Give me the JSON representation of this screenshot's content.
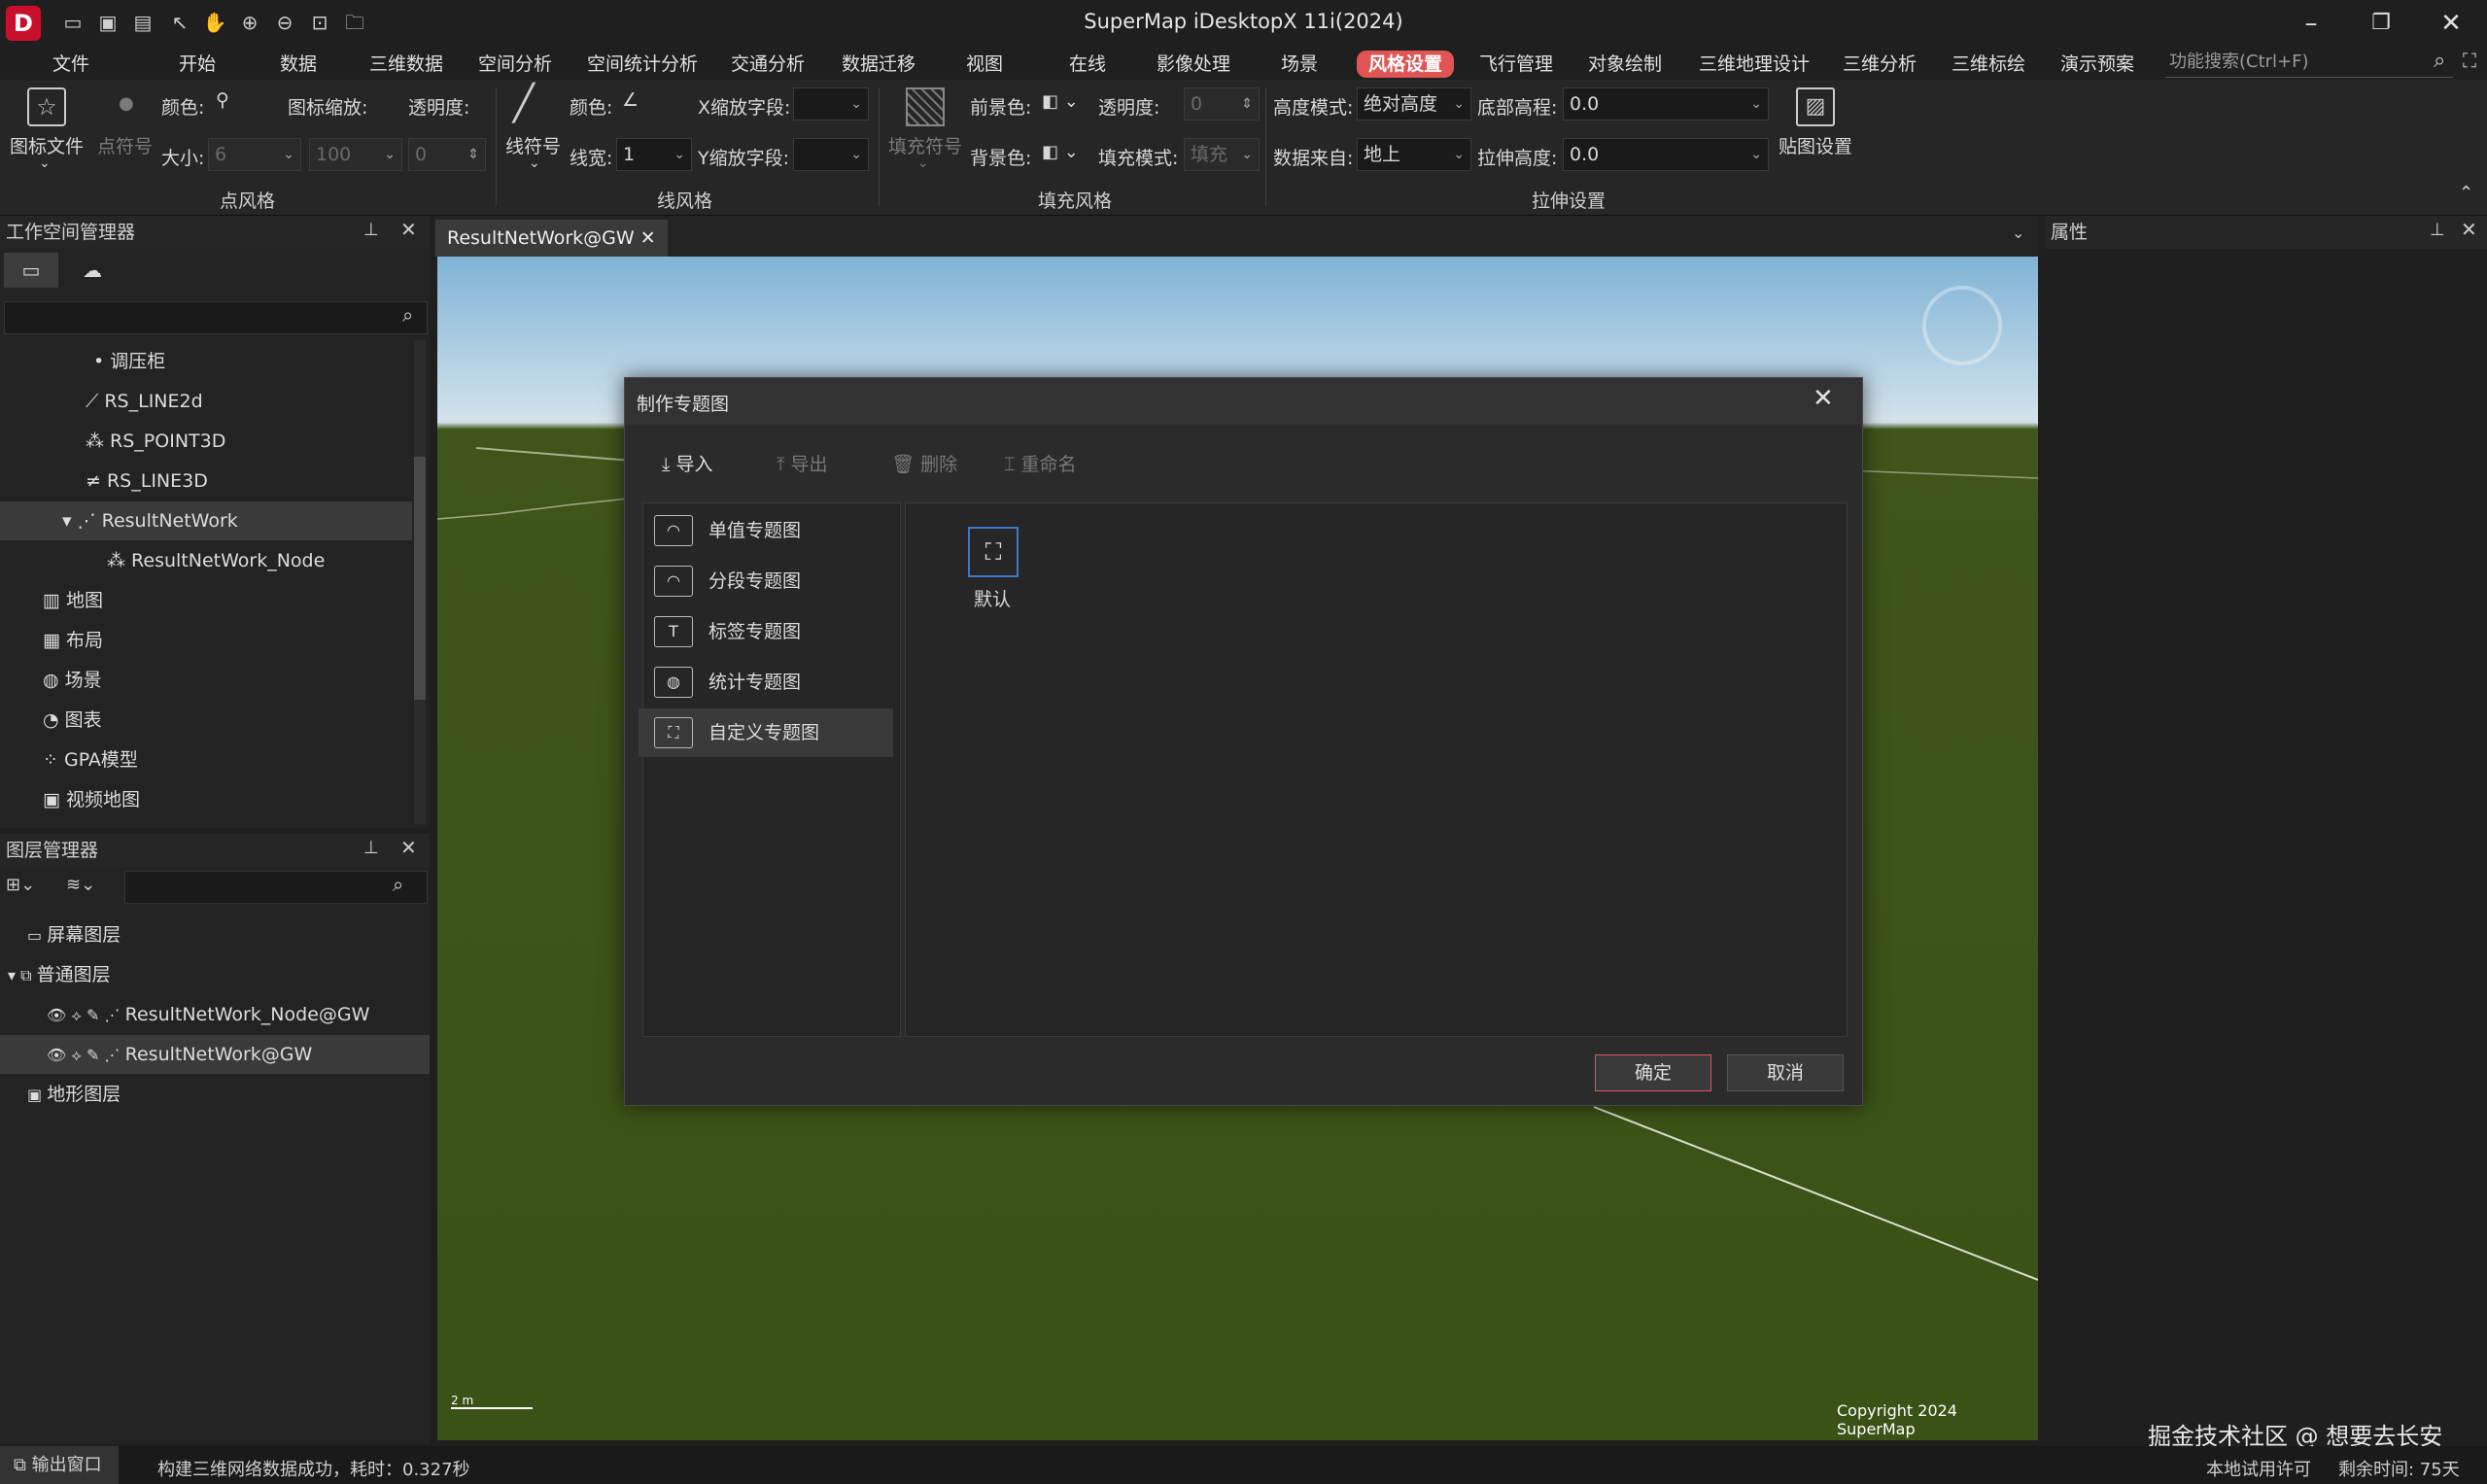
{
  "app": {
    "title": "SuperMap iDesktopX 11i(2024)",
    "logo": "D"
  },
  "quick_access_icons": [
    "save-icon",
    "save-as-icon",
    "save-all-icon",
    "select-icon",
    "pan-icon",
    "zoom-in-icon",
    "zoom-out-icon",
    "full-extent-icon",
    "open-folder-icon"
  ],
  "menu": [
    "文件",
    "开始",
    "数据",
    "三维数据",
    "空间分析",
    "空间统计分析",
    "交通分析",
    "数据迁移",
    "视图",
    "在线",
    "影像处理",
    "场景",
    "风格设置",
    "飞行管理",
    "对象绘制",
    "三维地理设计",
    "三维分析",
    "三维标绘",
    "演示预案"
  ],
  "menu_active": "风格设置",
  "search_placeholder": "功能搜索(Ctrl+F)",
  "ribbon": {
    "point": {
      "icon_file": "图标文件",
      "point_symbol": "点符号",
      "color": "颜色:",
      "icon_scale": "图标缩放:",
      "opacity": "透明度:",
      "size": "大小:",
      "size_val": "6",
      "scale_val": "100",
      "opacity_val": "0",
      "group": "点风格"
    },
    "line": {
      "line_symbol": "线符号",
      "color": "颜色:",
      "width": "线宽:",
      "width_val": "1",
      "x_scale": "X缩放字段:",
      "y_scale": "Y缩放字段:",
      "group": "线风格"
    },
    "fill": {
      "fill_symbol": "填充符号",
      "fg": "前景色:",
      "bg": "背景色:",
      "opacity": "透明度:",
      "opacity_val": "0",
      "fill_mode": "填充模式:",
      "fill_mode_val": "填充",
      "group": "填充风格"
    },
    "extrude": {
      "height_mode": "高度模式:",
      "height_mode_val": "绝对高度",
      "bottom": "底部高程:",
      "bottom_val": "0.0",
      "source": "数据来自:",
      "source_val": "地上",
      "extrude_h": "拉伸高度:",
      "extrude_val": "0.0",
      "texture": "贴图设置",
      "group": "拉伸设置"
    }
  },
  "workspace": {
    "title": "工作空间管理器",
    "items": [
      {
        "label": "调压柜",
        "icon": "point-dataset-icon"
      },
      {
        "label": "RS_LINE2d",
        "icon": "line-dataset-icon"
      },
      {
        "label": "RS_POINT3D",
        "icon": "point3d-dataset-icon"
      },
      {
        "label": "RS_LINE3D",
        "icon": "line3d-dataset-icon"
      },
      {
        "label": "ResultNetWork",
        "icon": "network-dataset-icon"
      },
      {
        "label": "ResultNetWork_Node",
        "icon": "point3d-dataset-icon"
      },
      {
        "label": "地图",
        "icon": "map-icon"
      },
      {
        "label": "布局",
        "icon": "layout-icon"
      },
      {
        "label": "场景",
        "icon": "scene-icon"
      },
      {
        "label": "图表",
        "icon": "chart-icon"
      },
      {
        "label": "GPA模型",
        "icon": "gpa-icon"
      },
      {
        "label": "视频地图",
        "icon": "video-map-icon"
      }
    ]
  },
  "layers": {
    "title": "图层管理器",
    "items": [
      {
        "label": "屏幕图层"
      },
      {
        "label": "普通图层"
      },
      {
        "label": "ResultNetWork_Node@GW"
      },
      {
        "label": "ResultNetWork@GW"
      },
      {
        "label": "地形图层"
      }
    ]
  },
  "doc_tab": "ResultNetWork@GW",
  "properties_title": "属性",
  "dialog": {
    "title": "制作专题图",
    "toolbar": {
      "import": "导入",
      "export": "导出",
      "delete": "删除",
      "rename": "重命名"
    },
    "themes": [
      {
        "label": "单值专题图",
        "icon": "unique-theme-icon"
      },
      {
        "label": "分段专题图",
        "icon": "range-theme-icon"
      },
      {
        "label": "标签专题图",
        "icon": "label-theme-icon"
      },
      {
        "label": "统计专题图",
        "icon": "graph-theme-icon"
      },
      {
        "label": "自定义专题图",
        "icon": "custom-theme-icon"
      }
    ],
    "selected_theme": 4,
    "template": {
      "label": "默认"
    },
    "ok": "确定",
    "cancel": "取消"
  },
  "map": {
    "copyright": "Copyright 2024 SuperMap",
    "scale": "2 m"
  },
  "watermark": "掘金技术社区 @ 想要去长安",
  "status": {
    "output": "输出窗口",
    "message": "构建三维网络数据成功，耗时：0.327秒",
    "license": "本地试用许可",
    "remaining": "剩余时间: 75天"
  },
  "colors": {
    "accent": "#e05454",
    "bg": "#1f1f1f",
    "panel": "#262626",
    "terrain": "#3a5216"
  }
}
